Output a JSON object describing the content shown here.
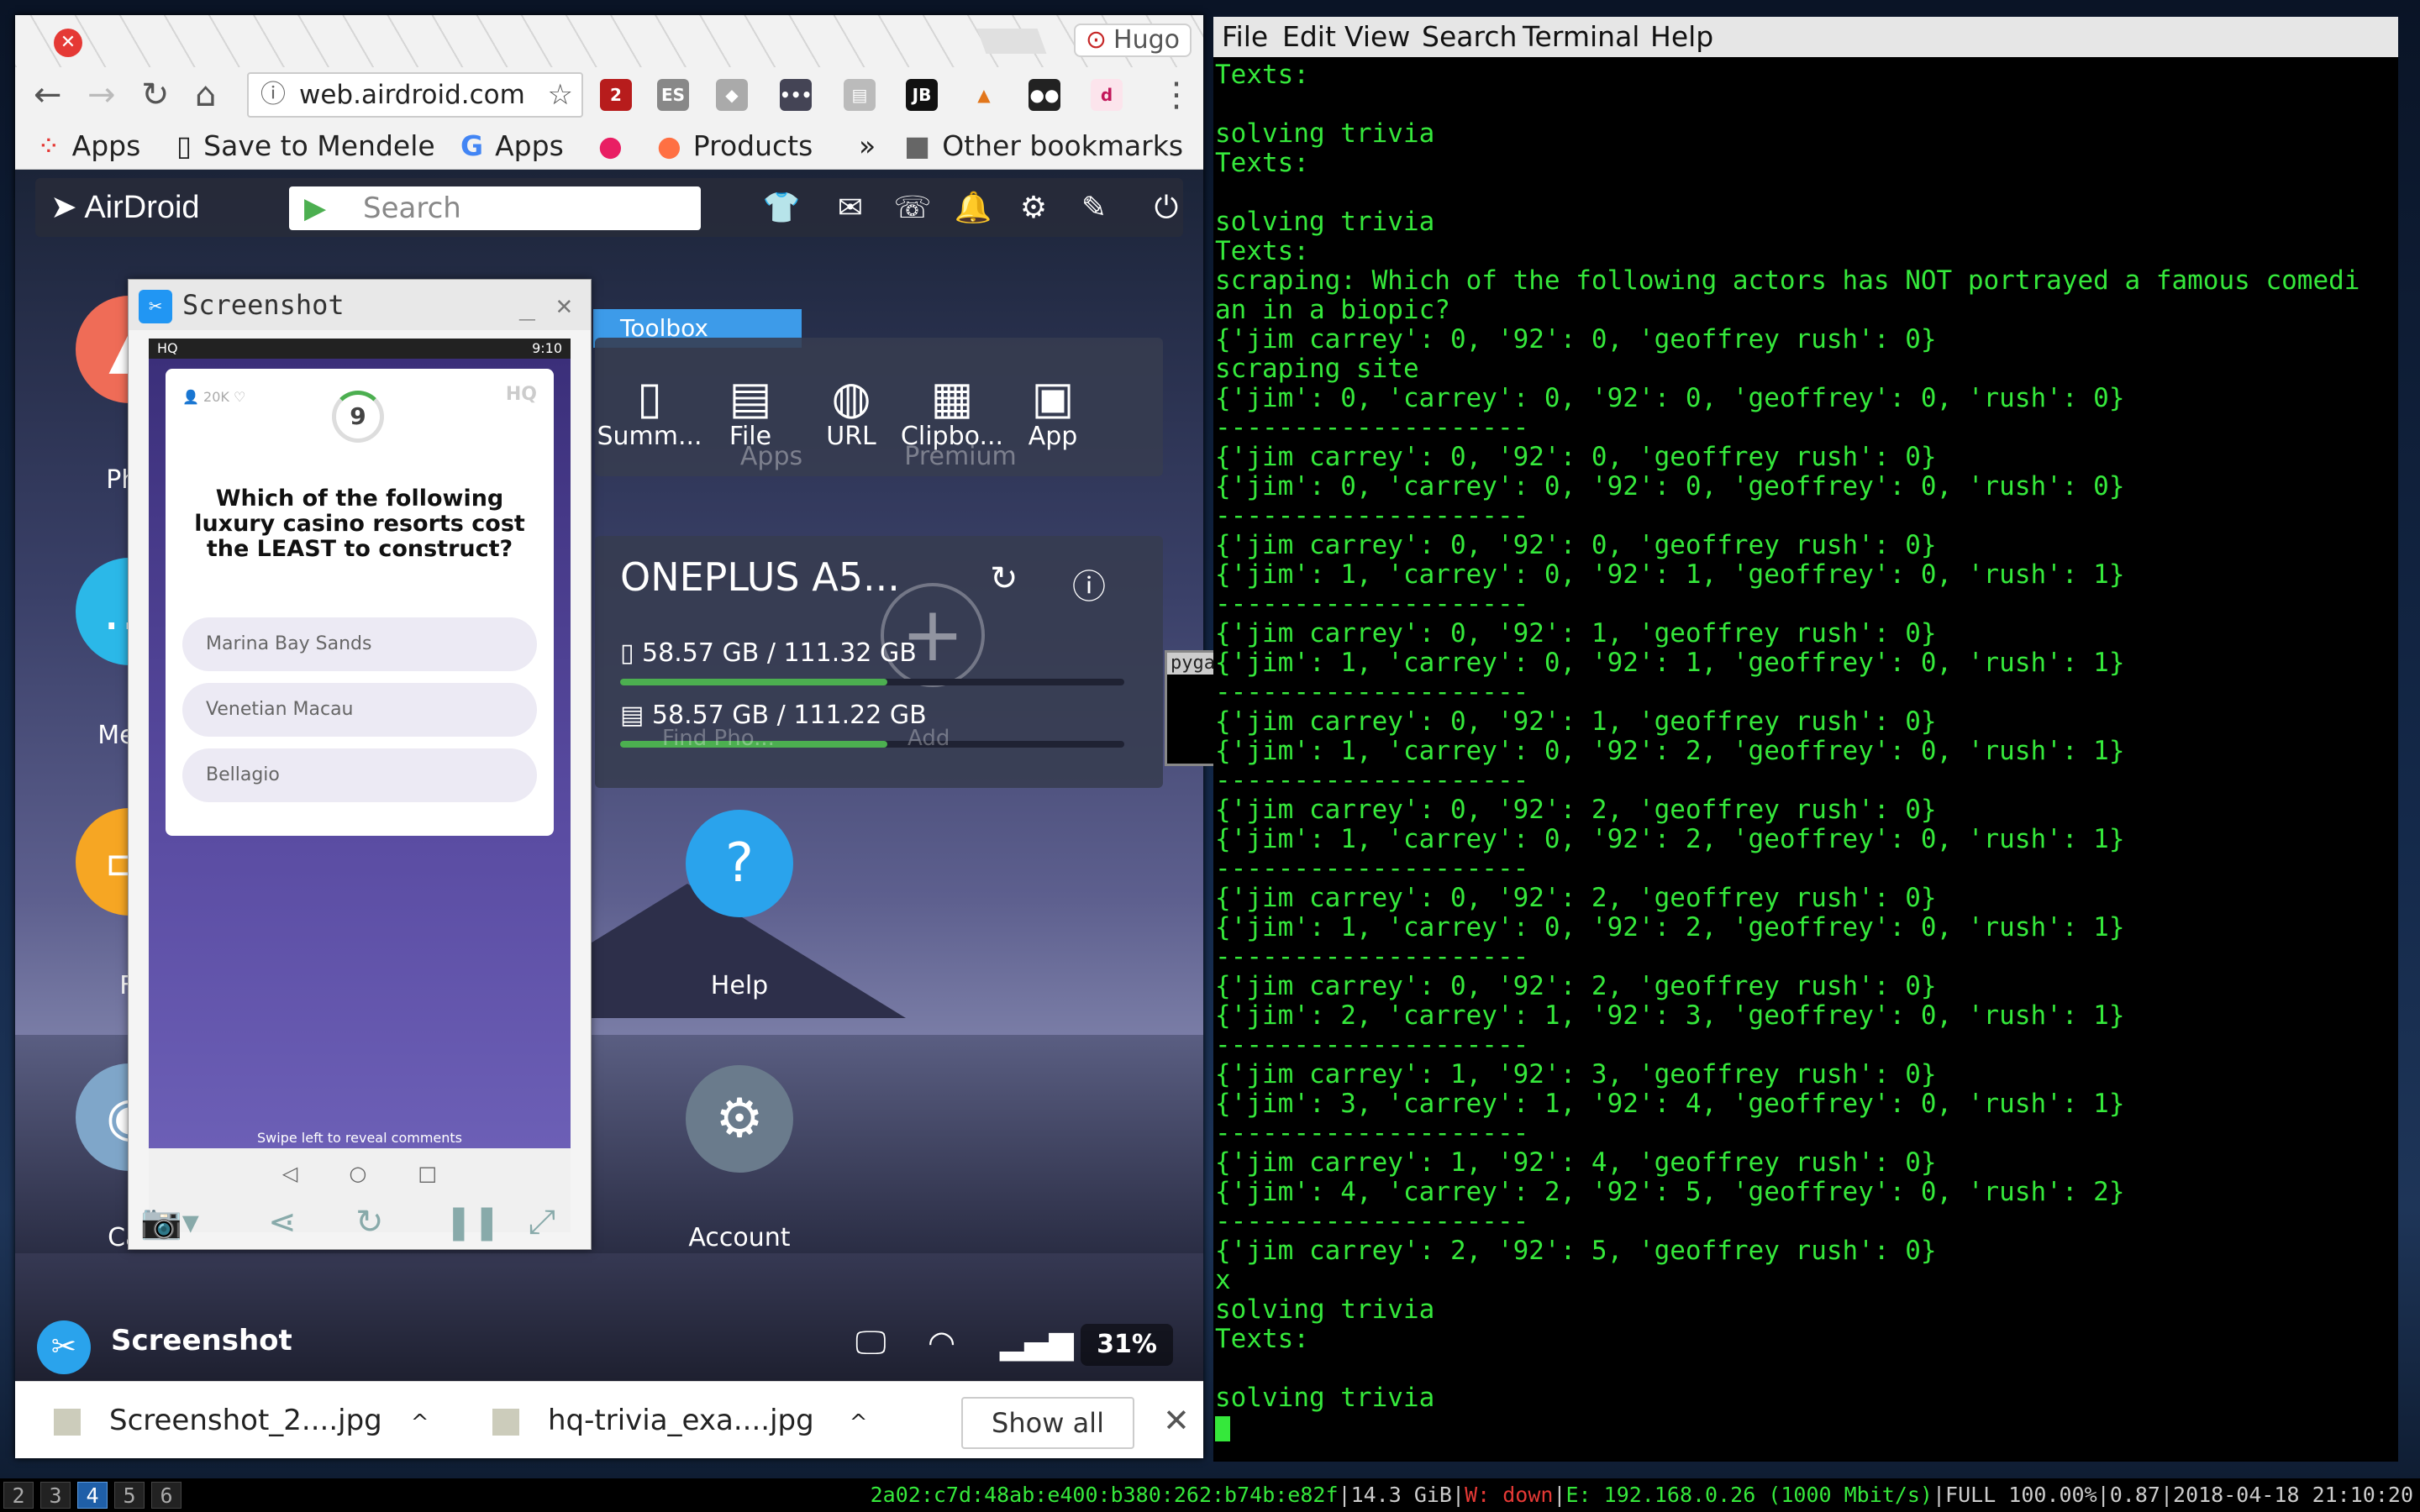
{
  "browser": {
    "profile": "Hugo",
    "url": "web.airdroid.com",
    "extensions": [
      "2",
      "ES",
      "JB",
      "d"
    ],
    "bookmarks": [
      "Apps",
      "Save to Mendele",
      "Apps",
      "Products",
      "»",
      "Other bookmarks"
    ]
  },
  "airdroid": {
    "logo": "AirDroid",
    "search_placeholder": "Search",
    "apps": [
      {
        "label": "Pho",
        "color": "#ef6c57"
      },
      {
        "label": "Mess",
        "color": "#2bb8e8"
      },
      {
        "label": "Fi",
        "color": "#f6a623"
      },
      {
        "label": "Car",
        "color": "#7fa6c9"
      },
      {
        "label": "Help",
        "color": "#2aa3ec"
      },
      {
        "label": "Account",
        "color": "#6a7b8c"
      }
    ],
    "ghost_labels": [
      "Apps",
      "Premium",
      "Find Pho...",
      "Add"
    ],
    "toolbox": {
      "tab": "Toolbox",
      "items": [
        "Summ...",
        "File",
        "URL",
        "Clipbo...",
        "App"
      ]
    },
    "device": {
      "name": "ONEPLUS A5...",
      "storage": [
        {
          "text": "58.57 GB / 111.32 GB",
          "fraction": 0.53
        },
        {
          "text": "58.57 GB / 111.22 GB",
          "fraction": 0.53
        }
      ]
    },
    "bottom": {
      "title": "Screenshot",
      "battery": "31%"
    }
  },
  "screenshot_dialog": {
    "title": "Screenshot",
    "phone_time": "9:10",
    "hq_logo": "HQ",
    "viewers": "20K",
    "timer": "9",
    "question": "Which of the following luxury casino resorts cost the LEAST to construct?",
    "options": [
      "Marina Bay Sands",
      "Venetian Macau",
      "Bellagio"
    ],
    "swipe_hint": "Swipe left to reveal comments"
  },
  "pygame": {
    "title": "pygam..."
  },
  "downloads": {
    "items": [
      "Screenshot_2....jpg",
      "hq-trivia_exa....jpg"
    ],
    "show_all": "Show all"
  },
  "terminal": {
    "menu": [
      "File",
      "Edit",
      "View",
      "Search",
      "Terminal",
      "Help"
    ],
    "lines": [
      "Texts:",
      "",
      "solving trivia",
      "Texts:",
      "",
      "solving trivia",
      "Texts:",
      "scraping: Which of the following actors has NOT portrayed a famous comedi",
      "an in a biopic?",
      "{'jim carrey': 0, '92': 0, 'geoffrey rush': 0}",
      "scraping site",
      "{'jim': 0, 'carrey': 0, '92': 0, 'geoffrey': 0, 'rush': 0}",
      "--------------------",
      "{'jim carrey': 0, '92': 0, 'geoffrey rush': 0}",
      "{'jim': 0, 'carrey': 0, '92': 0, 'geoffrey': 0, 'rush': 0}",
      "--------------------",
      "{'jim carrey': 0, '92': 0, 'geoffrey rush': 0}",
      "{'jim': 1, 'carrey': 0, '92': 1, 'geoffrey': 0, 'rush': 1}",
      "--------------------",
      "{'jim carrey': 0, '92': 1, 'geoffrey rush': 0}",
      "{'jim': 1, 'carrey': 0, '92': 1, 'geoffrey': 0, 'rush': 1}",
      "--------------------",
      "{'jim carrey': 0, '92': 1, 'geoffrey rush': 0}",
      "{'jim': 1, 'carrey': 0, '92': 2, 'geoffrey': 0, 'rush': 1}",
      "--------------------",
      "{'jim carrey': 0, '92': 2, 'geoffrey rush': 0}",
      "{'jim': 1, 'carrey': 0, '92': 2, 'geoffrey': 0, 'rush': 1}",
      "--------------------",
      "{'jim carrey': 0, '92': 2, 'geoffrey rush': 0}",
      "{'jim': 1, 'carrey': 0, '92': 2, 'geoffrey': 0, 'rush': 1}",
      "--------------------",
      "{'jim carrey': 0, '92': 2, 'geoffrey rush': 0}",
      "{'jim': 2, 'carrey': 1, '92': 3, 'geoffrey': 0, 'rush': 1}",
      "--------------------",
      "{'jim carrey': 1, '92': 3, 'geoffrey rush': 0}",
      "{'jim': 3, 'carrey': 1, '92': 4, 'geoffrey': 0, 'rush': 1}",
      "--------------------",
      "{'jim carrey': 1, '92': 4, 'geoffrey rush': 0}",
      "{'jim': 4, 'carrey': 2, '92': 5, 'geoffrey': 0, 'rush': 2}",
      "--------------------",
      "{'jim carrey': 2, '92': 5, 'geoffrey rush': 0}",
      "x",
      "solving trivia",
      "Texts:",
      "",
      "solving trivia"
    ]
  },
  "statusbar": {
    "workspaces": [
      "2",
      "3",
      "4",
      "5",
      "6"
    ],
    "active_workspace": "4",
    "ipv6": "2a02:c7d:48ab:e400:b380:262:b74b:e82f",
    "disk": "14.3 GiB",
    "wifi": "W: down",
    "eth": "E: 192.168.0.26 (1000 Mbit/s)",
    "battery": "FULL 100.00%",
    "load": "0.87",
    "datetime": "2018-04-18 21:10:20"
  }
}
